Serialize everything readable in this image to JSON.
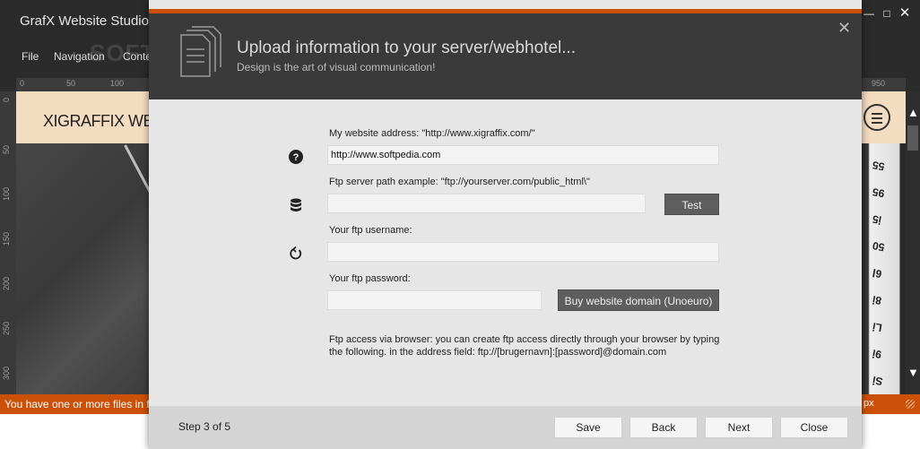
{
  "app": {
    "title": "GrafX Website Studio",
    "menu": [
      "File",
      "Navigation",
      "Conte"
    ],
    "watermark": "SOFTPEDIA",
    "window_controls": {
      "minimize": "—",
      "maximize": "□",
      "close": "✕"
    },
    "ruler_top": [
      "0",
      "50",
      "100",
      "950"
    ],
    "ruler_left": [
      "0",
      "50",
      "100",
      "150",
      "200",
      "250",
      "300"
    ],
    "site": {
      "logo": "XIGRAFFIX WEBDI",
      "tape_numbers": [
        "55",
        "95",
        "ⅰ5",
        "50",
        "6Ⅰ",
        "8ⅰ",
        "Lⅰ",
        "9ⅰ",
        "Sⅰ"
      ]
    },
    "scroll": {
      "up": "▲",
      "down": "▼"
    },
    "status": {
      "message": "You have one or more files in f",
      "right_text": "px"
    }
  },
  "dialog": {
    "close_icon": "✕",
    "icon": "document-stack-icon",
    "title": "Upload information to your server/webhotel...",
    "subtitle": "Design is the art of visual communication!",
    "fields": {
      "website": {
        "label": "My website address: \"http://www.xigraffix.com/\"",
        "value": "http://www.softpedia.com",
        "icon": "help-icon"
      },
      "ftp_path": {
        "label": "Ftp server path example: \"ftp://yourserver.com/public_html\\\"",
        "value": "",
        "icon": "database-icon",
        "button": "Test"
      },
      "username": {
        "label": "Your ftp username:",
        "value": "",
        "icon": "refresh-icon"
      },
      "password": {
        "label": "Your ftp password:",
        "value": "",
        "button": "Buy website domain (Unoeuro)"
      }
    },
    "note_line1": "Ftp access via browser: you can create ftp access directly through your browser by typing",
    "note_line2": "the following. in the address field: ftp://[brugernavn]:[password]@domain.com",
    "footer": {
      "step": "Step 3 of 5",
      "buttons": {
        "save": "Save",
        "back": "Back",
        "next": "Next",
        "close": "Close"
      }
    }
  },
  "colors": {
    "accent": "#cc5108",
    "header_bg": "#3a3a3a",
    "dialog_bg": "#e6e6e6",
    "site_header": "#f4dcc1"
  }
}
